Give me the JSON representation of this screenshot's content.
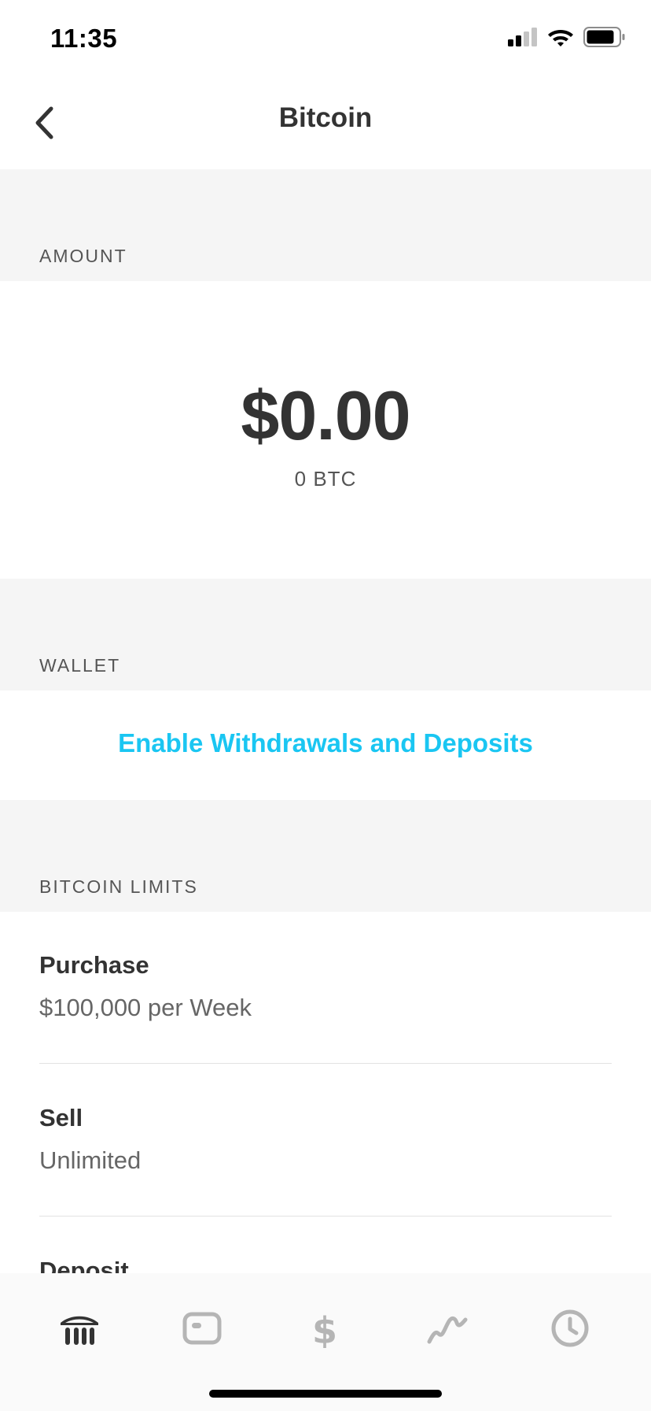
{
  "status_bar": {
    "time": "11:35"
  },
  "header": {
    "title": "Bitcoin"
  },
  "sections": {
    "amount": "AMOUNT",
    "wallet": "WALLET",
    "limits": "BITCOIN LIMITS"
  },
  "amount": {
    "usd": "$0.00",
    "btc": "0 BTC"
  },
  "wallet": {
    "link_label": "Enable Withdrawals and Deposits"
  },
  "limits": [
    {
      "label": "Purchase",
      "value": "$100,000 per Week"
    },
    {
      "label": "Sell",
      "value": "Unlimited"
    },
    {
      "label": "Deposit",
      "value": ""
    }
  ],
  "tab_bar": {
    "tabs": [
      {
        "icon": "bank-icon",
        "active": true
      },
      {
        "icon": "card-icon",
        "active": false
      },
      {
        "icon": "dollar-icon",
        "active": false
      },
      {
        "icon": "investing-icon",
        "active": false
      },
      {
        "icon": "clock-icon",
        "active": false
      }
    ]
  },
  "colors": {
    "accent": "#1ac6f2",
    "active_tab": "#333333",
    "inactive_tab": "#b5b5b5",
    "section_bg": "#f5f5f5"
  }
}
